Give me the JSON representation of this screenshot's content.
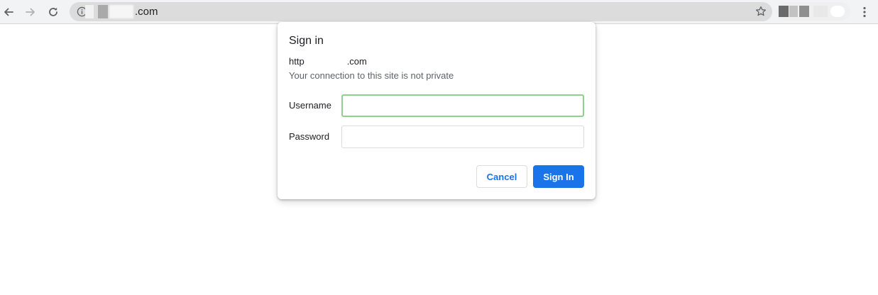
{
  "browser": {
    "url_visible_suffix": ".com",
    "icons": {
      "back": "arrow-left",
      "forward": "arrow-right",
      "reload": "reload",
      "site_info": "info-circle",
      "bookmark": "star-outline",
      "menu": "three-dots-vertical"
    }
  },
  "dialog": {
    "title": "Sign in",
    "origin_prefix": "http",
    "origin_suffix": ".com",
    "warning": "Your connection to this site is not private",
    "username_label": "Username",
    "username_value": "",
    "password_label": "Password",
    "password_value": "",
    "cancel_label": "Cancel",
    "signin_label": "Sign In"
  },
  "colors": {
    "accent": "#1a73e8",
    "focus_border": "#8fd08f",
    "toolbar_bg": "#f1f3f4",
    "omnibox_bg": "#dcdcdc"
  }
}
